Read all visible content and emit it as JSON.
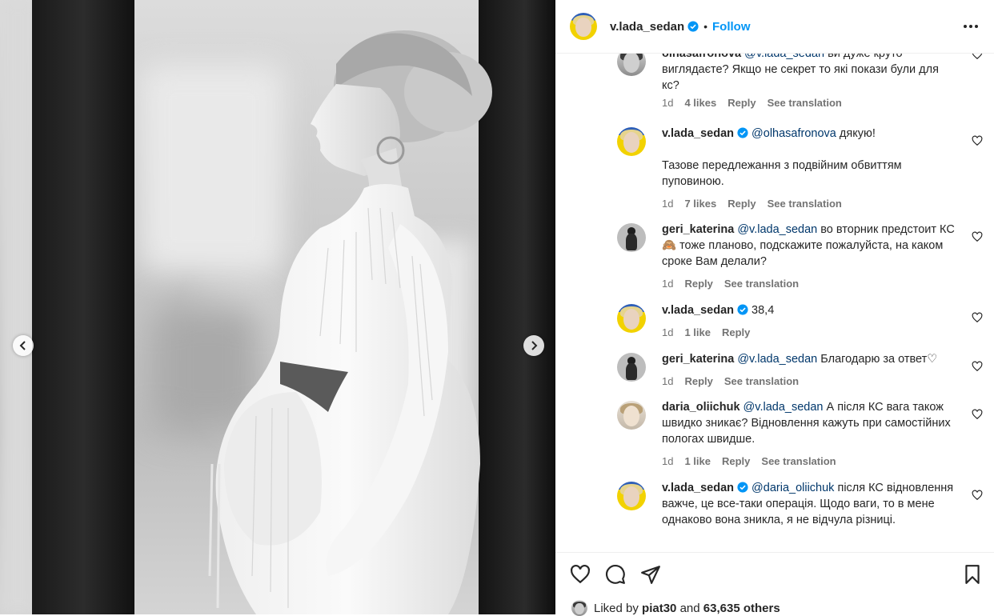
{
  "post": {
    "username": "v.lada_sedan",
    "follow_label": "Follow",
    "dot": "•"
  },
  "comments": [
    {
      "user": "olhasafronova",
      "mention": "@v.lada_sedan",
      "text": " ви дуже круто виглядаєте? Якщо не секрет то які покази були для кс?",
      "time": "1d",
      "likes": "4 likes",
      "reply": "Reply",
      "translation": "See translation",
      "verified": false
    },
    {
      "user": "v.lada_sedan",
      "mention": "@olhasafronova",
      "text": " дякую!",
      "text2": "Тазове передлежання з подвійним обвиттям пуповиною.",
      "time": "1d",
      "likes": "7 likes",
      "reply": "Reply",
      "translation": "See translation",
      "verified": true
    },
    {
      "user": "geri_katerina",
      "mention": "@v.lada_sedan",
      "text": " во вторник предстоит КС 🙈 тоже планово, подскажите пожалуйста, на каком сроке Вам делали?",
      "time": "1d",
      "likes": "",
      "reply": "Reply",
      "translation": "See translation",
      "verified": false
    },
    {
      "user": "v.lada_sedan",
      "mention": "",
      "text": " 38,4",
      "time": "1d",
      "likes": "1 like",
      "reply": "Reply",
      "translation": "",
      "verified": true
    },
    {
      "user": "geri_katerina",
      "mention": "@v.lada_sedan",
      "text": " Благодарю за ответ♡",
      "time": "1d",
      "likes": "",
      "reply": "Reply",
      "translation": "See translation",
      "verified": false
    },
    {
      "user": "daria_oliichuk",
      "mention": "@v.lada_sedan",
      "text": " А після КС вага також швидко зникає? Відновлення кажуть при самостійних пологах швидше.",
      "time": "1d",
      "likes": "1 like",
      "reply": "Reply",
      "translation": "See translation",
      "verified": false
    },
    {
      "user": "v.lada_sedan",
      "mention": "@daria_oliichuk",
      "text": " після КС відновлення важче, це все-таки операція. Щодо ваги, то в мене однаково вона зникла, я не відчула різниці.",
      "time": "",
      "likes": "",
      "reply": "",
      "translation": "",
      "verified": true
    }
  ],
  "likes": {
    "prefix": "Liked by ",
    "user": "piat30",
    "middle": " and ",
    "count": "63,635 others"
  },
  "icons": {
    "verified": "verified-badge-icon",
    "more": "more-options-icon",
    "heart": "heart-icon",
    "comment": "comment-icon",
    "share": "share-icon",
    "save": "bookmark-icon",
    "prev": "chevron-left-icon",
    "next": "chevron-right-icon"
  },
  "colors": {
    "accent": "#0095f6",
    "mention": "#00376b",
    "meta": "#737373",
    "verified": "#0095f6"
  }
}
